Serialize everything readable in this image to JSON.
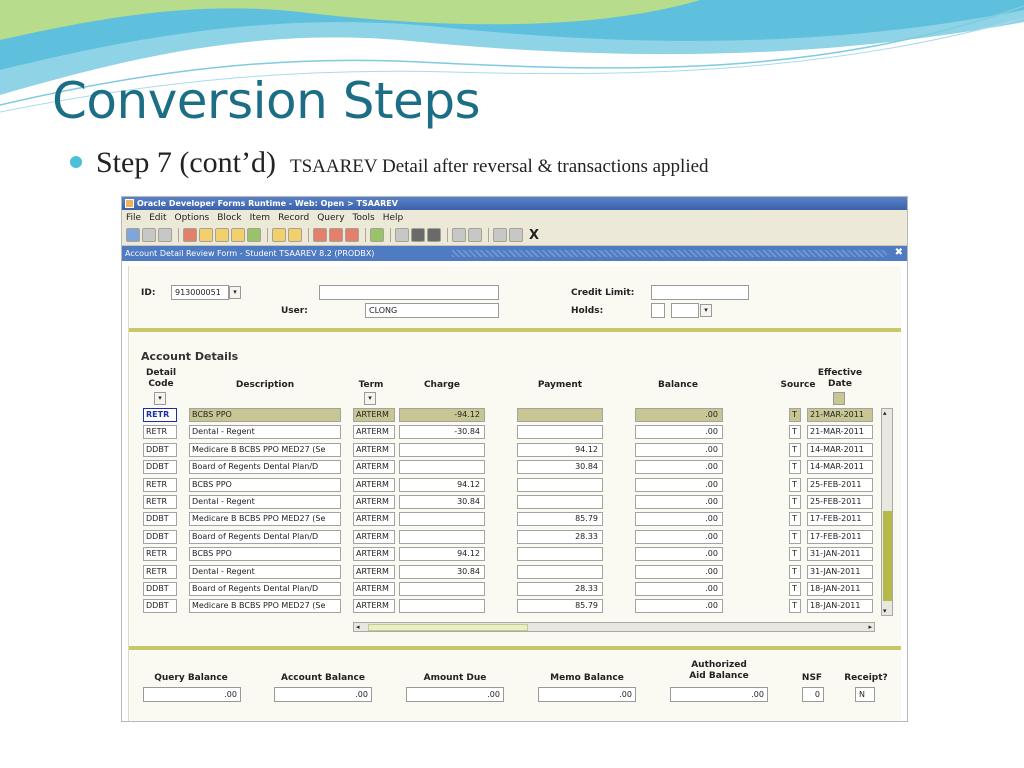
{
  "slide": {
    "title": "Conversion Steps",
    "bullet_main": "Step 7 (cont’d)",
    "bullet_sub": "TSAAREV Detail after reversal & transactions applied"
  },
  "window": {
    "title": "Oracle Developer Forms Runtime - Web: Open > TSAAREV",
    "menus": [
      "File",
      "Edit",
      "Options",
      "Block",
      "Item",
      "Record",
      "Query",
      "Tools",
      "Help"
    ],
    "form_title": "Account Detail Review Form - Student TSAAREV 8.2 (PRODBX)",
    "close_glyph": "✖"
  },
  "key_block": {
    "id_label": "ID:",
    "id_value": "913000051",
    "user_label": "User:",
    "user_value": "CLONG",
    "credit_limit_label": "Credit Limit:",
    "holds_label": "Holds:"
  },
  "account_details": {
    "section_title": "Account Details",
    "headers": {
      "detail_code": "Detail\nCode",
      "description": "Description",
      "term": "Term",
      "charge": "Charge",
      "payment": "Payment",
      "balance": "Balance",
      "source": "Source",
      "effective_date": "Effective\nDate"
    },
    "rows": [
      {
        "code": "RETR",
        "desc": "BCBS PPO",
        "term": "ARTERM",
        "charge": "-94.12",
        "payment": "",
        "balance": ".00",
        "source": "T",
        "date": "21-MAR-2011"
      },
      {
        "code": "RETR",
        "desc": "Dental - Regent",
        "term": "ARTERM",
        "charge": "-30.84",
        "payment": "",
        "balance": ".00",
        "source": "T",
        "date": "21-MAR-2011"
      },
      {
        "code": "DDBT",
        "desc": "Medicare B BCBS PPO MED27 (Se",
        "term": "ARTERM",
        "charge": "",
        "payment": "94.12",
        "balance": ".00",
        "source": "T",
        "date": "14-MAR-2011"
      },
      {
        "code": "DDBT",
        "desc": "Board of Regents Dental Plan/D",
        "term": "ARTERM",
        "charge": "",
        "payment": "30.84",
        "balance": ".00",
        "source": "T",
        "date": "14-MAR-2011"
      },
      {
        "code": "RETR",
        "desc": "BCBS PPO",
        "term": "ARTERM",
        "charge": "94.12",
        "payment": "",
        "balance": ".00",
        "source": "T",
        "date": "25-FEB-2011"
      },
      {
        "code": "RETR",
        "desc": "Dental - Regent",
        "term": "ARTERM",
        "charge": "30.84",
        "payment": "",
        "balance": ".00",
        "source": "T",
        "date": "25-FEB-2011"
      },
      {
        "code": "DDBT",
        "desc": "Medicare B BCBS PPO MED27 (Se",
        "term": "ARTERM",
        "charge": "",
        "payment": "85.79",
        "balance": ".00",
        "source": "T",
        "date": "17-FEB-2011"
      },
      {
        "code": "DDBT",
        "desc": "Board of Regents Dental Plan/D",
        "term": "ARTERM",
        "charge": "",
        "payment": "28.33",
        "balance": ".00",
        "source": "T",
        "date": "17-FEB-2011"
      },
      {
        "code": "RETR",
        "desc": "BCBS PPO",
        "term": "ARTERM",
        "charge": "94.12",
        "payment": "",
        "balance": ".00",
        "source": "T",
        "date": "31-JAN-2011"
      },
      {
        "code": "RETR",
        "desc": "Dental - Regent",
        "term": "ARTERM",
        "charge": "30.84",
        "payment": "",
        "balance": ".00",
        "source": "T",
        "date": "31-JAN-2011"
      },
      {
        "code": "DDBT",
        "desc": "Board of Regents Dental Plan/D",
        "term": "ARTERM",
        "charge": "",
        "payment": "28.33",
        "balance": ".00",
        "source": "T",
        "date": "18-JAN-2011"
      },
      {
        "code": "DDBT",
        "desc": "Medicare B BCBS PPO MED27 (Se",
        "term": "ARTERM",
        "charge": "",
        "payment": "85.79",
        "balance": ".00",
        "source": "T",
        "date": "18-JAN-2011"
      }
    ]
  },
  "footer": {
    "query_balance_label": "Query Balance",
    "query_balance": ".00",
    "account_balance_label": "Account Balance",
    "account_balance": ".00",
    "amount_due_label": "Amount Due",
    "amount_due": ".00",
    "memo_balance_label": "Memo Balance",
    "memo_balance": ".00",
    "authorized_aid_label": "Authorized\nAid Balance",
    "authorized_aid": ".00",
    "nsf_label": "NSF",
    "nsf": "0",
    "receipt_label": "Receipt?",
    "receipt": "N"
  },
  "icons": {
    "dropdown": "▾",
    "scroll_up": "▴",
    "scroll_down": "▾",
    "scroll_left": "◂",
    "scroll_right": "▸",
    "exit": "X"
  }
}
